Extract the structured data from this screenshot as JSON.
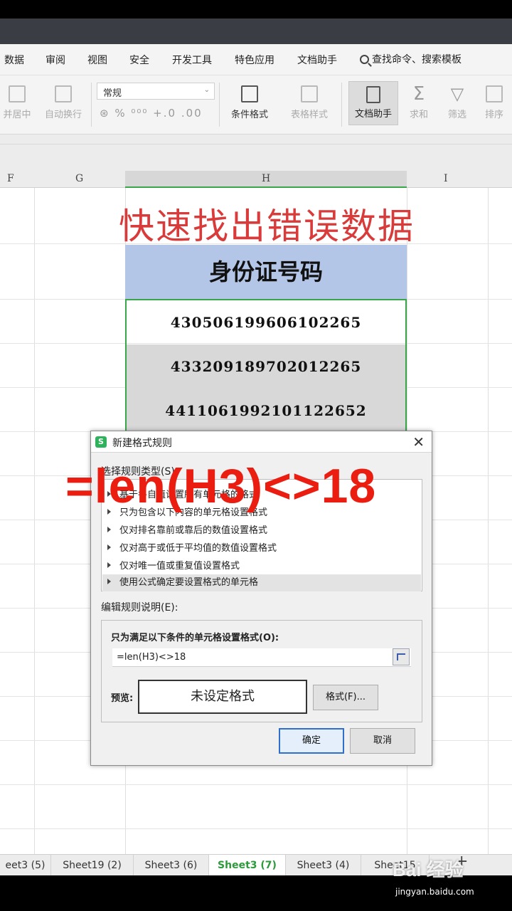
{
  "menu": {
    "items": [
      "数据",
      "审阅",
      "视图",
      "安全",
      "开发工具",
      "特色应用",
      "文档助手"
    ],
    "search_label": "查找命令、搜索模板"
  },
  "ribbon": {
    "merge_center": "并居中",
    "auto_wrap": "自动换行",
    "number_format": "常规",
    "number_row": "%  ⁰⁰⁰  +.0  .00",
    "conditional_format": "条件格式",
    "table_style": "表格样式",
    "doc_assistant": "文档助手",
    "sum": "求和",
    "filter": "筛选",
    "sort": "排序"
  },
  "columns": [
    "F",
    "G",
    "H",
    "I"
  ],
  "sheet": {
    "title": "快速找出错误数据",
    "id_header": "身份证号码",
    "ids": [
      "430506199606102265",
      "433209189702012265",
      "441106199210112265​2"
    ]
  },
  "dialog": {
    "title": "新建格式规则",
    "select_rule_type": "选择规则类型(S):",
    "rule_types": [
      "基于各自值设置所有单元格的格式",
      "只为包含以下内容的单元格设置格式",
      "仅对排名靠前或靠后的数值设置格式",
      "仅对高于或低于平均值的数值设置格式",
      "仅对唯一值或重复值设置格式",
      "使用公式确定要设置格式的单元格"
    ],
    "edit_rule_desc": "编辑规则说明(E):",
    "formula_label": "只为满足以下条件的单元格设置格式(O):",
    "formula_value": "=len(H3)<>18",
    "preview_label": "预览:",
    "preview_text": "未设定格式",
    "format_button": "格式(F)...",
    "ok_button": "确定",
    "cancel_button": "取消"
  },
  "overlay_formula": "=len(H3)<>18",
  "tabs": [
    "eet3 (5)",
    "Sheet19 (2)",
    "Sheet3 (6)",
    "Sheet3 (7)",
    "Sheet3 (4)",
    "Sheet15"
  ],
  "active_tab_index": 3,
  "watermark": {
    "brand": "Bai 经验",
    "url": "jingyan.baidu.com"
  },
  "colors": {
    "title_red": "#d93a3a",
    "overlay_red": "#ea1d10",
    "header_blue": "#b4c6e7",
    "selection_green": "#3aa64a"
  }
}
